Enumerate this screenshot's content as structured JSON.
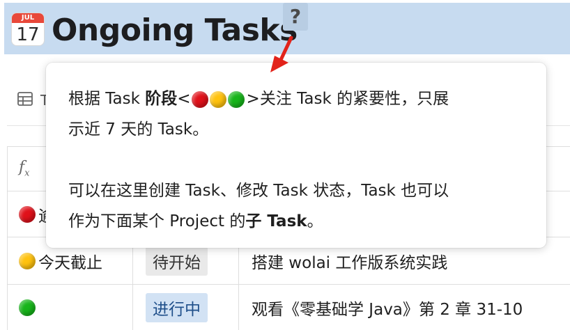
{
  "header": {
    "calendar_month": "JUL",
    "calendar_day": "17",
    "title": "Ongoing Tasks",
    "help_label": "?"
  },
  "tooltip": {
    "line1_a": "根据 Task ",
    "line1_bold": "阶段",
    "line1_b": "<",
    "line1_c": ">关注 Task 的紧要性，只展",
    "line2": "示近 7 天的 Task。",
    "line3": "可以在这里创建 Task、修改 Task 状态，Task 也可以",
    "line4_a": "作为下面某个 Project 的",
    "line4_bold": "子 Task",
    "line4_b": "。",
    "status_dots": [
      "red",
      "yellow",
      "green"
    ]
  },
  "view_bar": {
    "icon": "table-icon",
    "label_stub": "T"
  },
  "table": {
    "header_icon": "formula-icon",
    "rows": [
      {
        "dot": "red",
        "due": "逾",
        "status": "",
        "status_style": "none",
        "task": ""
      },
      {
        "dot": "yellow",
        "due": "今天截止",
        "status": "待开始",
        "status_style": "gray",
        "task": "搭建 wolai 工作版系统实践"
      },
      {
        "dot": "green",
        "due": "",
        "status": "进行中",
        "status_style": "blue",
        "task": "观看《零基础学 Java》第 2 章 31-10"
      }
    ]
  },
  "colors": {
    "header_bg": "#c7dbf0",
    "red": "#e0111a",
    "yellow": "#ffc20e",
    "green": "#17b51a",
    "arrow": "#e2231a"
  }
}
